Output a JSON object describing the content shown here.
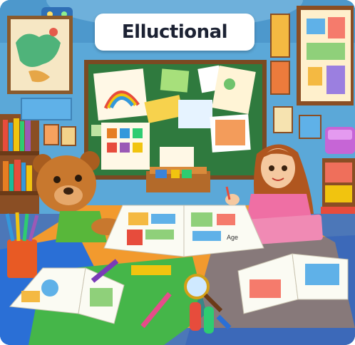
{
  "title": {
    "text": "Elluctional"
  },
  "book": {
    "page_text": "Age"
  },
  "palette": {
    "wall": "#5ba8d8",
    "board": "#2f7a3e",
    "table_orange": "#f29a2e",
    "table_blue": "#2a6fd6",
    "table_green": "#45b649",
    "bear": "#c8782e",
    "girl_hair": "#b0561f",
    "girl_shirt": "#ef6fa4"
  }
}
